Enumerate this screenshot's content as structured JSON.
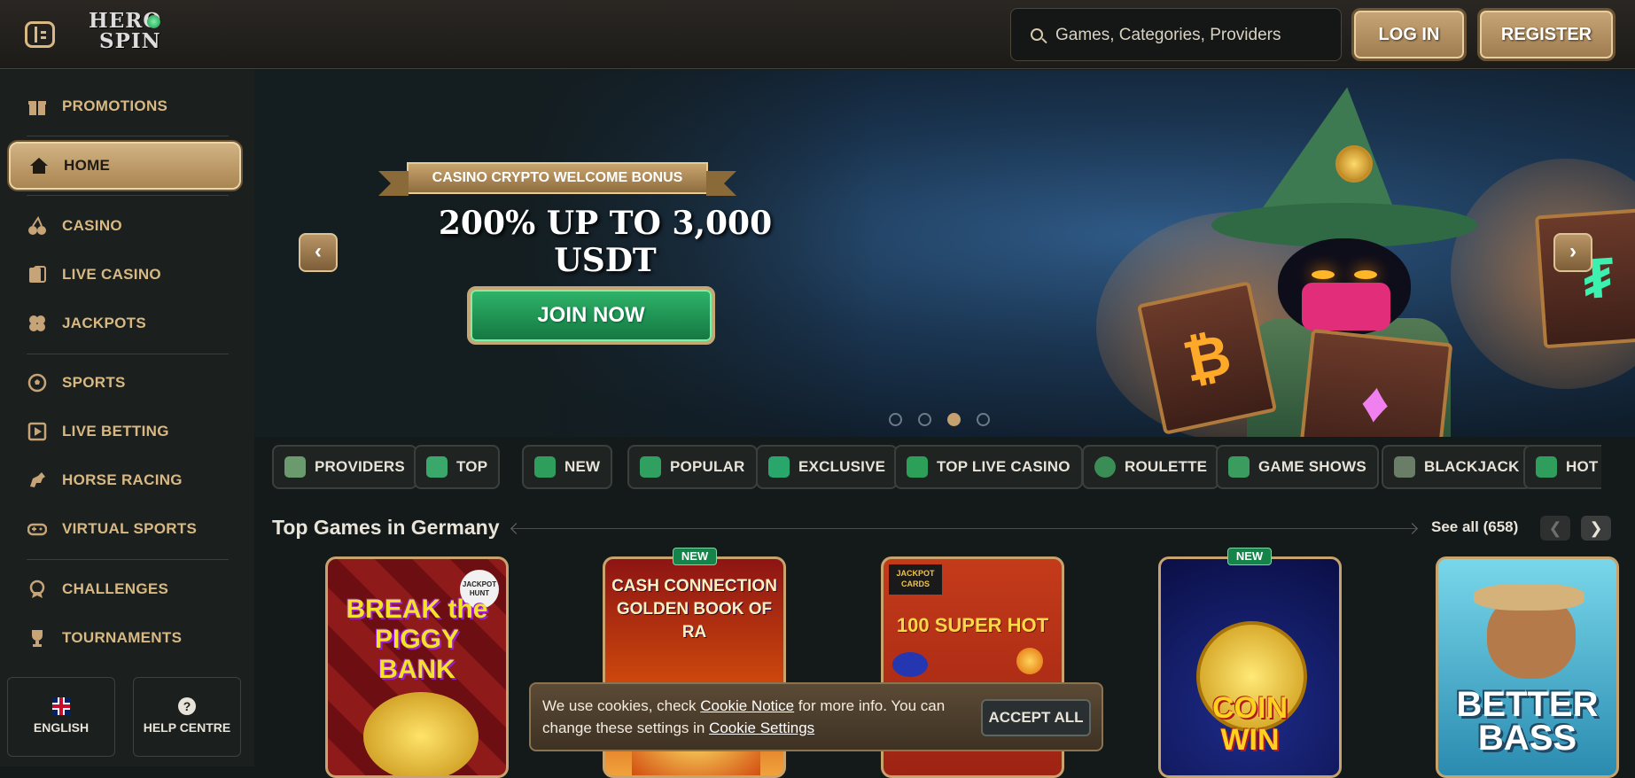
{
  "header": {
    "logo_line1": "HERO",
    "logo_line2": "SPIN",
    "search_placeholder": "Games, Categories, Providers",
    "login_label": "LOG IN",
    "register_label": "REGISTER"
  },
  "sidebar": {
    "items": [
      {
        "label": "PROMOTIONS",
        "icon": "gift-icon"
      },
      {
        "label": "HOME",
        "icon": "home-icon",
        "active": true
      },
      {
        "label": "CASINO",
        "icon": "cherries-icon"
      },
      {
        "label": "LIVE CASINO",
        "icon": "cards-icon"
      },
      {
        "label": "JACKPOTS",
        "icon": "clover-icon"
      },
      {
        "label": "SPORTS",
        "icon": "soccer-ball-icon"
      },
      {
        "label": "LIVE BETTING",
        "icon": "live-play-icon"
      },
      {
        "label": "HORSE RACING",
        "icon": "horse-icon"
      },
      {
        "label": "VIRTUAL SPORTS",
        "icon": "gamepad-icon"
      },
      {
        "label": "CHALLENGES",
        "icon": "medal-icon"
      },
      {
        "label": "TOURNAMENTS",
        "icon": "trophy-icon"
      }
    ],
    "language_label": "ENGLISH",
    "help_label": "HELP CENTRE",
    "help_glyph": "?"
  },
  "hero": {
    "ribbon": "CASINO CRYPTO WELCOME BONUS",
    "title": "200% UP TO 3,000 USDT",
    "cta": "JOIN NOW",
    "prev_glyph": "‹",
    "next_glyph": "›",
    "slide_count": 4,
    "active_slide": 3,
    "book_symbols": [
      "₿",
      "♦",
      "₮"
    ]
  },
  "categories": [
    {
      "label": "PROVIDERS",
      "color": "#6a9a6e"
    },
    {
      "label": "TOP",
      "color": "#3aa86a"
    },
    {
      "label": "NEW",
      "color": "#2f9d5c"
    },
    {
      "label": "POPULAR",
      "color": "#2fa060"
    },
    {
      "label": "EXCLUSIVE",
      "color": "#29a66b"
    },
    {
      "label": "TOP LIVE CASINO",
      "color": "#2c9f58"
    },
    {
      "label": "ROULETTE",
      "color": "#3b8d56"
    },
    {
      "label": "GAME SHOWS",
      "color": "#3a9c5e"
    },
    {
      "label": "BLACKJACK",
      "color": "#6a7d66"
    },
    {
      "label": "HOT",
      "color": "#2f9d5c"
    }
  ],
  "section": {
    "title": "Top Games in Germany",
    "see_all": "See all (658)",
    "prev_glyph": "❮",
    "next_glyph": "❯"
  },
  "games": [
    {
      "title": "BREAK the PIGGY BANK",
      "badge": "",
      "corner": "JACKPOT HUNT"
    },
    {
      "title": "CASH CONNECTION GOLDEN BOOK OF RA",
      "badge": "NEW"
    },
    {
      "title": "100 SUPER HOT",
      "badge": "",
      "corner": "JACKPOT CARDS"
    },
    {
      "title": "COIN WIN",
      "badge": "NEW"
    },
    {
      "title": "BETTER BASS",
      "badge": ""
    }
  ],
  "cookie": {
    "text_1": "We use cookies, check ",
    "link_1": "Cookie Notice",
    "text_2": " for more info. You can change these settings in ",
    "link_2": "Cookie Settings",
    "accept": "ACCEPT ALL"
  },
  "colors": {
    "gold": "#d8b983",
    "green_cta": "#1f9a55",
    "background": "#141a19"
  }
}
